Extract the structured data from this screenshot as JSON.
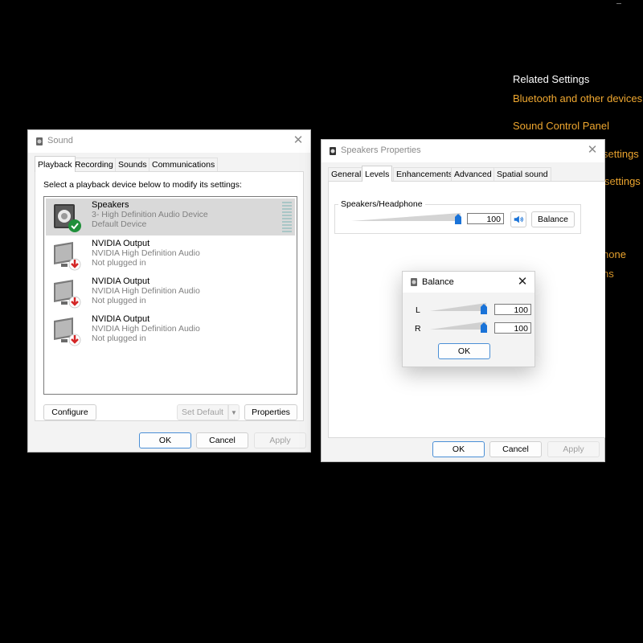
{
  "background": {
    "related_heading": "Related Settings",
    "links": [
      "Bluetooth and other devices",
      "Sound Control Panel",
      "settings",
      "settings",
      "hone",
      "ns"
    ]
  },
  "sound_dialog": {
    "title": "Sound",
    "tabs": [
      "Playback",
      "Recording",
      "Sounds",
      "Communications"
    ],
    "instruction": "Select a playback device below to modify its settings:",
    "devices": [
      {
        "name": "Speakers",
        "detail": "3- High Definition Audio Device",
        "status": "Default Device",
        "icon": "speaker-default-icon"
      },
      {
        "name": "NVIDIA Output",
        "detail": "NVIDIA High Definition Audio",
        "status": "Not plugged in",
        "icon": "monitor-unplugged-icon"
      },
      {
        "name": "NVIDIA Output",
        "detail": "NVIDIA High Definition Audio",
        "status": "Not plugged in",
        "icon": "monitor-unplugged-icon"
      },
      {
        "name": "NVIDIA Output",
        "detail": "NVIDIA High Definition Audio",
        "status": "Not plugged in",
        "icon": "monitor-unplugged-icon"
      }
    ],
    "configure_label": "Configure",
    "set_default_label": "Set Default",
    "properties_label": "Properties",
    "ok_label": "OK",
    "cancel_label": "Cancel",
    "apply_label": "Apply"
  },
  "speakers_dialog": {
    "title": "Speakers Properties",
    "tabs": [
      "General",
      "Levels",
      "Enhancements",
      "Advanced",
      "Spatial sound"
    ],
    "group_label": "Speakers/Headphone",
    "volume_value": "100",
    "balance_label": "Balance",
    "ok_label": "OK",
    "cancel_label": "Cancel",
    "apply_label": "Apply"
  },
  "balance_dialog": {
    "title": "Balance",
    "left_label": "L",
    "left_value": "100",
    "right_label": "R",
    "right_value": "100",
    "ok_label": "OK"
  },
  "colors": {
    "accent": "#1a73d8",
    "link": "#f0a830",
    "success": "#1f8f3a",
    "error": "#d42626"
  }
}
